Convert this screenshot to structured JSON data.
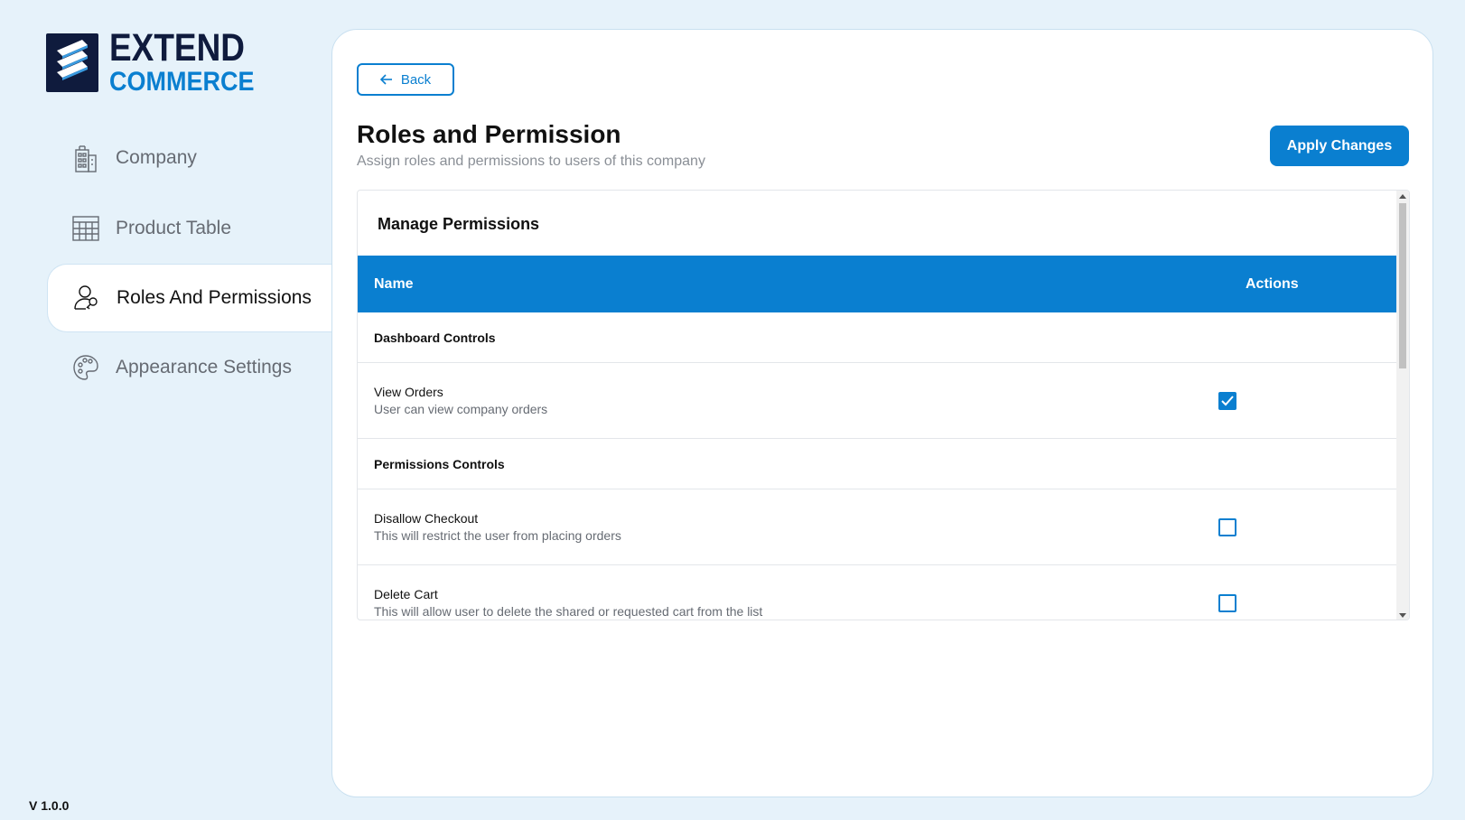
{
  "brand": {
    "line1": "EXTEND",
    "line2": "COMMERCE",
    "primary_color": "#0f1b3d",
    "accent_color": "#0a7fd0"
  },
  "sidebar": {
    "items": [
      {
        "label": "Company",
        "icon": "building-icon",
        "active": false
      },
      {
        "label": "Product Table",
        "icon": "table-icon",
        "active": false
      },
      {
        "label": "Roles And Permissions",
        "icon": "user-key-icon",
        "active": true
      },
      {
        "label": "Appearance Settings",
        "icon": "palette-icon",
        "active": false
      }
    ]
  },
  "version": "V 1.0.0",
  "main": {
    "back_label": "Back",
    "title": "Roles and Permission",
    "subtitle": "Assign roles and permissions to users of this company",
    "apply_label": "Apply Changes",
    "card_title": "Manage Permissions",
    "table": {
      "headers": {
        "name": "Name",
        "actions": "Actions"
      },
      "groups": [
        {
          "label": "Dashboard Controls",
          "permissions": [
            {
              "title": "View Orders",
              "description": "User can view company orders",
              "checked": true
            }
          ]
        },
        {
          "label": "Permissions Controls",
          "permissions": [
            {
              "title": "Disallow Checkout",
              "description": "This will restrict the user from placing orders",
              "checked": false
            },
            {
              "title": "Delete Cart",
              "description": "This will allow user to delete the shared or requested cart from the list",
              "checked": false
            }
          ]
        }
      ]
    }
  }
}
